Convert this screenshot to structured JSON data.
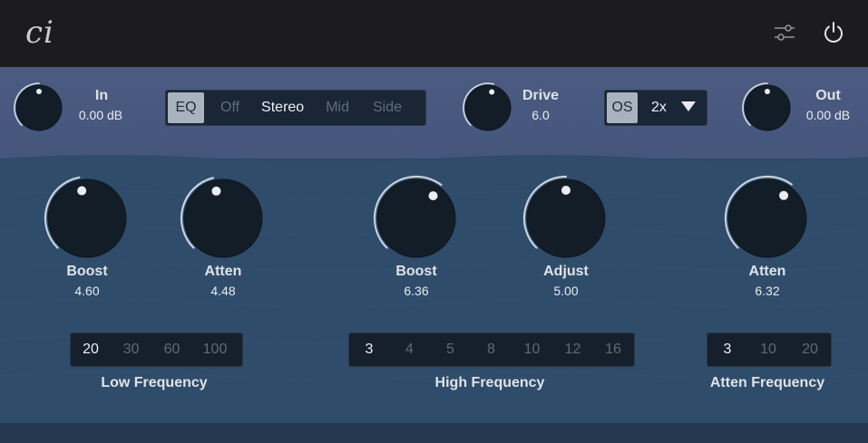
{
  "header": {
    "logo_text": "ci",
    "settings_icon": "sliders-icon",
    "power_icon": "power-icon"
  },
  "colors": {
    "panel": "#2e4a66",
    "top_band": "#4b5a80",
    "knob_body": "#131d28",
    "arc": "#c9d2dc",
    "segment_bg": "#15202c"
  },
  "input": {
    "label": "In",
    "value": "0.00 dB"
  },
  "mode": {
    "tag": "EQ",
    "options": [
      "Off",
      "Stereo",
      "Mid",
      "Side"
    ],
    "selected": "Stereo"
  },
  "drive": {
    "label": "Drive",
    "value": "6.0"
  },
  "oversampling": {
    "tag": "OS",
    "value": "2x",
    "caret_icon": "caret-down-icon"
  },
  "output": {
    "label": "Out",
    "value": "0.00 dB"
  },
  "low": {
    "boost": {
      "label": "Boost",
      "value": "4.60"
    },
    "atten": {
      "label": "Atten",
      "value": "4.48"
    },
    "frequency": {
      "label": "Low Frequency",
      "options": [
        "20",
        "30",
        "60",
        "100"
      ],
      "selected": "20"
    }
  },
  "high": {
    "boost": {
      "label": "Boost",
      "value": "6.36"
    },
    "adjust": {
      "label": "Adjust",
      "value": "5.00"
    },
    "frequency": {
      "label": "High Frequency",
      "options": [
        "3",
        "4",
        "5",
        "8",
        "10",
        "12",
        "16"
      ],
      "selected": "3"
    }
  },
  "high_atten": {
    "atten": {
      "label": "Atten",
      "value": "6.32"
    },
    "frequency": {
      "label": "Atten Frequency",
      "options": [
        "3",
        "10",
        "20"
      ],
      "selected": "3"
    }
  },
  "knob_positions": {
    "input": 0.5,
    "drive": 0.55,
    "output": 0.5,
    "low_boost": 0.46,
    "low_atten": 0.448,
    "high_boost": 0.636,
    "high_adjust": 0.5,
    "high_atten": 0.632
  }
}
